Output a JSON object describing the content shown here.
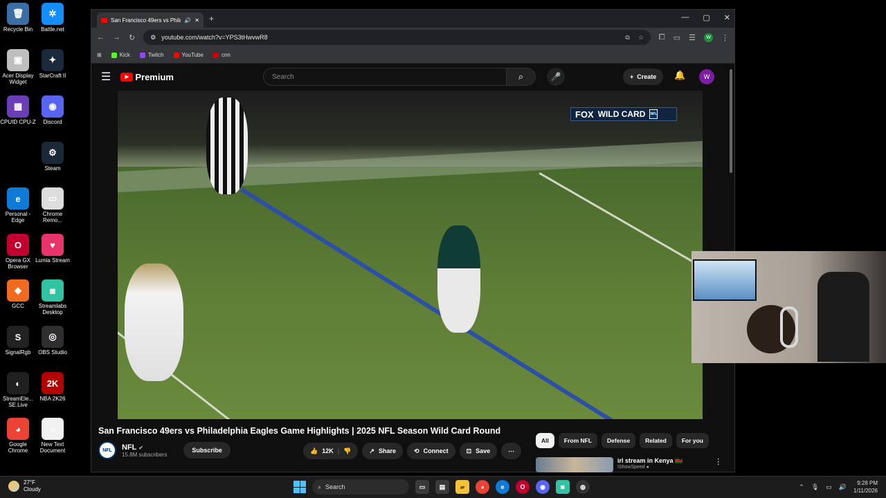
{
  "desktop": {
    "icons": [
      {
        "label": "Recycle Bin",
        "glyph": "🗑",
        "color": "#3a6ea5"
      },
      {
        "label": "Battle.net",
        "glyph": "✲",
        "color": "#148eff"
      },
      {
        "label": "Acer Display Widget",
        "glyph": "▣",
        "color": "#bfbfbf"
      },
      {
        "label": "StarCraft II",
        "glyph": "✦",
        "color": "#1a2a3a"
      },
      {
        "label": "CPUID CPU-Z",
        "glyph": "▦",
        "color": "#6a3fb5"
      },
      {
        "label": "Discord",
        "glyph": "◉",
        "color": "#5865f2"
      },
      {
        "label": "Steam",
        "glyph": "⚙",
        "color": "#1b2838"
      },
      {
        "label": "Personal - Edge",
        "glyph": "e",
        "color": "#0f7bd8"
      },
      {
        "label": "Chrome Remo...",
        "glyph": "▭",
        "color": "#dddddd"
      },
      {
        "label": "Opera GX Browser",
        "glyph": "O",
        "color": "#c2002f"
      },
      {
        "label": "Lumia Stream",
        "glyph": "♥",
        "color": "#e8336b"
      },
      {
        "label": "GCC",
        "glyph": "◆",
        "color": "#f06a20"
      },
      {
        "label": "Streamlabs Desktop",
        "glyph": "◙",
        "color": "#31c3a2"
      },
      {
        "label": "SignalRgb",
        "glyph": "S",
        "color": "#222222"
      },
      {
        "label": "OBS Studio",
        "glyph": "◎",
        "color": "#302e31"
      },
      {
        "label": "StreamEle... SE.Live",
        "glyph": "◐",
        "color": "#202020"
      },
      {
        "label": "NBA 2K26",
        "glyph": "2K",
        "color": "#b30000"
      },
      {
        "label": "Google Chrome",
        "glyph": "◕",
        "color": "#ea4335"
      },
      {
        "label": "New Text Document",
        "glyph": "≡",
        "color": "#f0f0f0"
      }
    ]
  },
  "browser": {
    "tab_title": "San Francisco 49ers vs Phila...",
    "url": "youtube.com/watch?v=YPS3tHwvwR8",
    "profile_initial": "W",
    "bookmarks": [
      {
        "label": "Kick",
        "color": "#53fc18"
      },
      {
        "label": "Twitch",
        "color": "#9146ff"
      },
      {
        "label": "YouTube",
        "color": "#ff0000"
      },
      {
        "label": "cnn",
        "color": "#cc0000"
      }
    ]
  },
  "youtube": {
    "brand": "Premium",
    "search_placeholder": "Search",
    "create_label": "Create",
    "user_initial": "W",
    "overlay": {
      "network": "FOX",
      "event": "WILD CARD"
    },
    "video_title": "San Francisco 49ers vs Philadelphia Eagles Game Highlights | 2025 NFL Season Wild Card Round",
    "channel": {
      "name": "NFL",
      "subscribers": "15.8M subscribers",
      "avatar_text": "NFL"
    },
    "subscribe_label": "Subscribe",
    "actions": {
      "likes": "12K",
      "share": "Share",
      "connect": "Connect",
      "save": "Save"
    },
    "chips": [
      "All",
      "From NFL",
      "Defense",
      "Related",
      "For you"
    ],
    "recommendation": {
      "title": "irl stream in Kenya 🇰🇪",
      "channel": "IShowSpeed ●"
    }
  },
  "taskbar": {
    "temperature": "27°F",
    "condition": "Cloudy",
    "search_label": "Search",
    "time": "9:28 PM",
    "date": "1/11/2026"
  }
}
